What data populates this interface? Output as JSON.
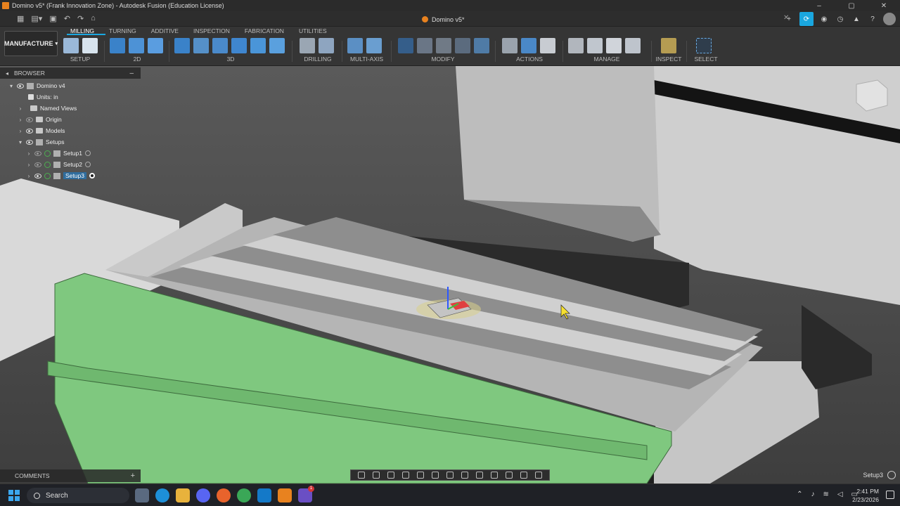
{
  "window": {
    "title": "Domino v5* (Frank Innovation Zone) - Autodesk Fusion (Education License)",
    "controls": [
      "–",
      "▢",
      "✕"
    ]
  },
  "document_tab": {
    "label": "Domino v5*",
    "close": "✕",
    "add": "+"
  },
  "ribbon": {
    "workspace": "MANUFACTURE",
    "tabs": [
      "MILLING",
      "TURNING",
      "ADDITIVE",
      "INSPECTION",
      "FABRICATION",
      "UTILITIES"
    ],
    "active_tab": "MILLING",
    "groups": {
      "setup": "SETUP",
      "twod": "2D",
      "threed": "3D",
      "drilling": "DRILLING",
      "multiaxis": "MULTI-AXIS",
      "modify": "MODIFY",
      "actions": "ACTIONS",
      "manage": "MANAGE",
      "inspect": "INSPECT",
      "select": "SELECT"
    }
  },
  "browser": {
    "title": "BROWSER",
    "collapse": "–",
    "items": [
      {
        "label": "Domino v4"
      },
      {
        "label": "Units: in"
      },
      {
        "label": "Named Views"
      },
      {
        "label": "Origin"
      },
      {
        "label": "Models"
      },
      {
        "label": "Setups"
      },
      {
        "label": "Setup1"
      },
      {
        "label": "Setup2"
      },
      {
        "label": "Setup3"
      }
    ]
  },
  "comments": {
    "label": "COMMENTS",
    "add": "+"
  },
  "status": {
    "active_setup": "Setup3"
  },
  "taskbar": {
    "search": "Search",
    "time": "2:41 PM",
    "date": "2/23/2026",
    "badge": "1"
  },
  "colors": {
    "accent": "#1aa7e0",
    "vise_green": "#7fc87f",
    "table_gray": "#b8b8b8",
    "window_bg": "#1e1e1e"
  }
}
